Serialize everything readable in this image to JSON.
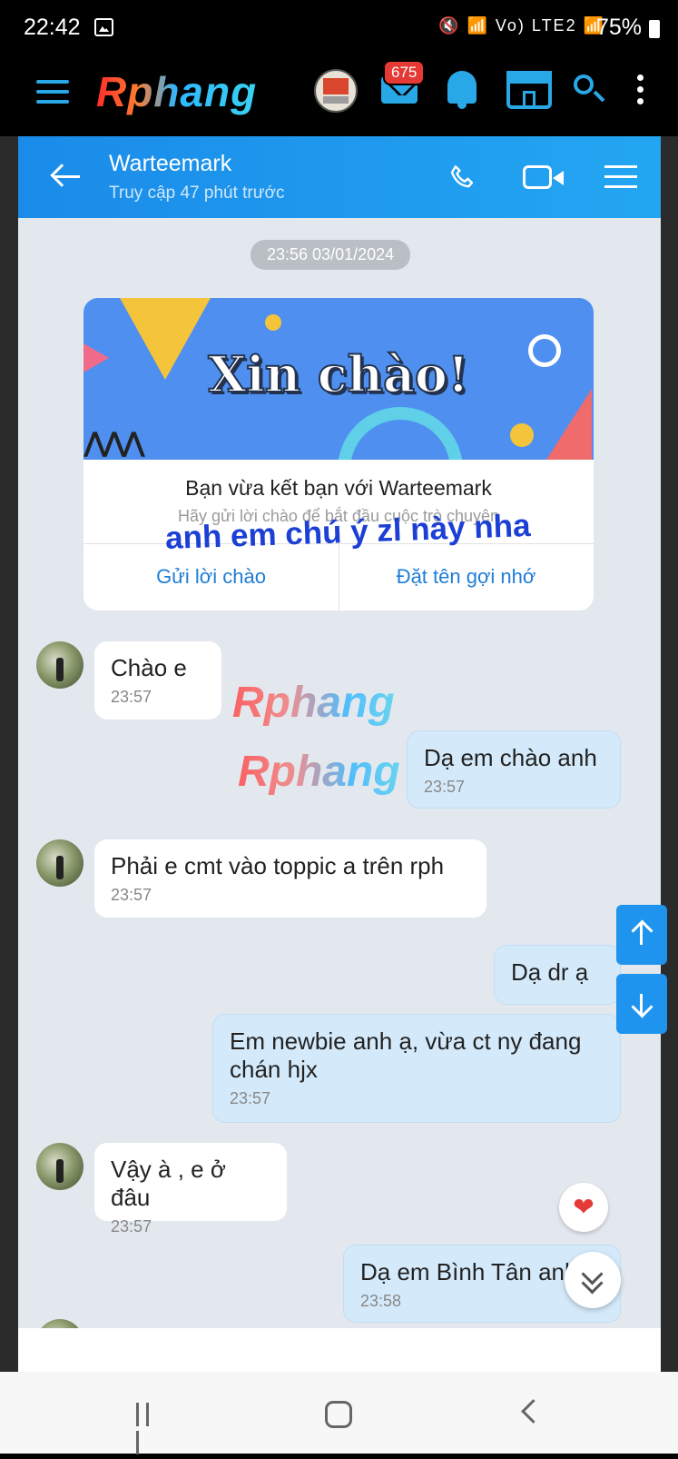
{
  "status_bar": {
    "time": "22:42",
    "icons": "🔇 📶 Vo) LTE2 📶",
    "battery": "75%"
  },
  "app_bar": {
    "logo": "Rphang",
    "mail_badge": "675"
  },
  "chat_header": {
    "name": "Warteemark",
    "status": "Truy cập 47 phút trước"
  },
  "chat": {
    "date_pill": "23:56 03/01/2024",
    "card": {
      "banner": "Xin chào!",
      "title": "Bạn vừa kết bạn với Warteemark",
      "subtitle": "Hãy gửi lời chào để bắt đầu cuộc trò chuyện",
      "button_left": "Gửi lời chào",
      "button_right": "Đặt tên gợi nhớ"
    },
    "overlay_text": "anh em chú ý zl này nha",
    "watermark": "Rphang",
    "messages": [
      {
        "dir": "in",
        "text": "Chào e",
        "time": "23:57"
      },
      {
        "dir": "out",
        "text": "Dạ em chào anh",
        "time": "23:57"
      },
      {
        "dir": "in",
        "text": "Phải e cmt vào toppic a trên rph",
        "time": "23:57"
      },
      {
        "dir": "out",
        "text": "Dạ dr ạ",
        "time": ""
      },
      {
        "dir": "out",
        "text": "Em newbie anh ạ, vừa ct ny đang chán hjx",
        "time": "23:57"
      },
      {
        "dir": "in",
        "text": "Vậy à , e ở đâu",
        "time": "23:57"
      },
      {
        "dir": "out",
        "text": "Dạ em Bình Tân anh ạ",
        "time": "23:58"
      }
    ]
  },
  "colors": {
    "header_blue": "#1a8be9",
    "accent": "#29a8e8",
    "bubble_out": "#d4eafb"
  },
  "icons": [
    "menu-icon",
    "mail-icon",
    "bell-icon",
    "store-icon",
    "search-icon",
    "more-icon",
    "back-icon",
    "phone-icon",
    "video-icon",
    "list-icon",
    "heart-icon",
    "chevron-double-down-icon",
    "arrow-up-icon",
    "arrow-down-icon"
  ]
}
